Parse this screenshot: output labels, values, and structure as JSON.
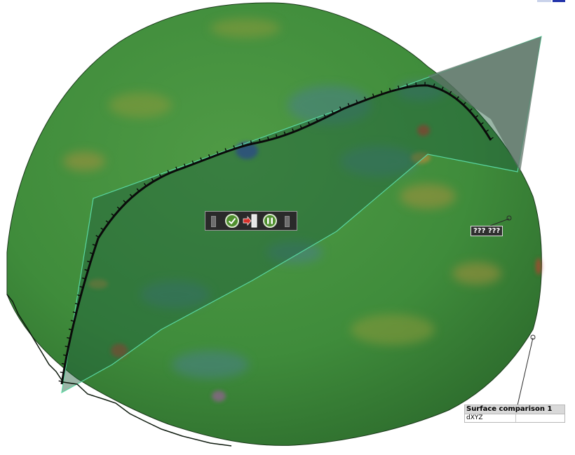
{
  "viewport": {
    "background": "#ffffff"
  },
  "colors": {
    "surface_main": "#3f8c3b",
    "surface_dark": "#2f6e2d",
    "plane_fill": "#1f5d3c",
    "plane_edge": "#59d6a0",
    "deviation_blue": "#3a4fa8",
    "deviation_red": "#b0442e",
    "deviation_orange": "#b7893a"
  },
  "mini_toolbar": {
    "buttons": [
      {
        "icon": "check-circle-icon"
      },
      {
        "icon": "arrow-into-door-icon"
      },
      {
        "icon": "pause-bars-icon"
      }
    ]
  },
  "point_label": {
    "text": "??? ???"
  },
  "comparison_table": {
    "title": "Surface comparison 1",
    "rows": [
      {
        "name": "dXYZ",
        "value": ""
      }
    ]
  }
}
